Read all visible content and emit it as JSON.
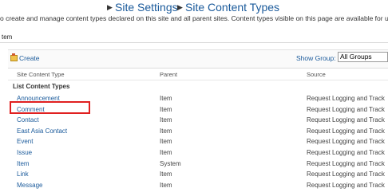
{
  "breadcrumb": {
    "items": [
      "Site Settings",
      "Site Content Types"
    ]
  },
  "description": "o create and manage content types declared on this site and all parent sites. Content types visible on this page are available for u",
  "scope": "tem",
  "toolbar": {
    "create_label": "Create",
    "show_group_label": "Show Group:",
    "show_group_value": "All Groups"
  },
  "table": {
    "headers": [
      "Site Content Type",
      "Parent",
      "Source"
    ],
    "group_title": "List Content Types",
    "rows": [
      {
        "name": "Announcement",
        "parent": "Item",
        "source": "Request Logging and Track"
      },
      {
        "name": "Comment",
        "parent": "Item",
        "source": "Request Logging and Track"
      },
      {
        "name": "Contact",
        "parent": "Item",
        "source": "Request Logging and Track"
      },
      {
        "name": "East Asia Contact",
        "parent": "Item",
        "source": "Request Logging and Track"
      },
      {
        "name": "Event",
        "parent": "Item",
        "source": "Request Logging and Track"
      },
      {
        "name": "Issue",
        "parent": "Item",
        "source": "Request Logging and Track"
      },
      {
        "name": "Item",
        "parent": "System",
        "source": "Request Logging and Track"
      },
      {
        "name": "Link",
        "parent": "Item",
        "source": "Request Logging and Track"
      },
      {
        "name": "Message",
        "parent": "Item",
        "source": "Request Logging and Track"
      }
    ]
  },
  "colors": {
    "link": "#1a5a9b",
    "highlight": "#e02020"
  },
  "icons": {
    "create": "new-content-type-icon",
    "breadcrumb_separator": "triangle-right-icon"
  }
}
